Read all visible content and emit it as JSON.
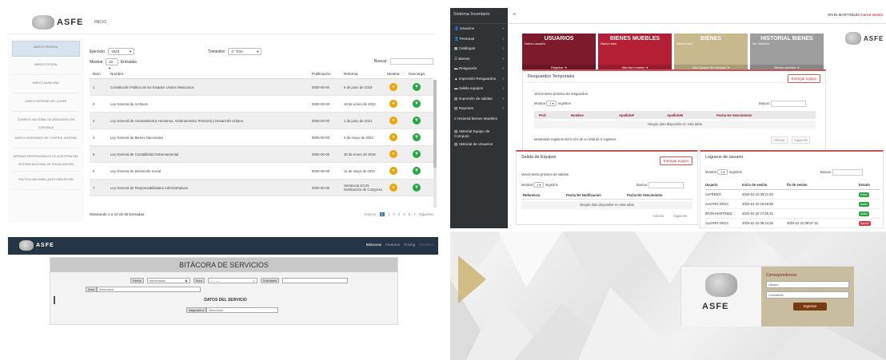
{
  "q1": {
    "brand": "ASFE",
    "header_title": "INICIO",
    "sidebar": [
      "MARCO FEDERAL",
      "MARCO ESTATAL",
      "MARCO MUNICIPAL",
      "MARCO INTERNO DE LA ASFE",
      "CONSEJO NACIONAL DE ARMONIZACIÓN CONTABLE",
      "MARCO INTEGRADO DE CONTROL INTERNO",
      "NORMAS PROFESIONALES DE AUDITORÍA DEL SISTEMA NACIONAL DE FISCALIZACIÓN",
      "POLÍTICA NACIONAL ANTICORRUPCIÓN"
    ],
    "ejercicio_label": "Ejercicio:",
    "ejercicio_value": "2023",
    "trimestre_label": "Trimestre:",
    "trimestre_value": "2° Trim.",
    "mostrar_label": "Mostrar",
    "mostrar_value": "10",
    "entradas_label": "Entradas",
    "buscar_label": "Buscar:",
    "cols": [
      "Núm",
      "Nombre",
      "Publicación",
      "Reforma",
      "Mostrar",
      "Descarga"
    ],
    "rows": [
      {
        "n": "1",
        "name": "Constitución Política de los Estados Unidos Mexicanos",
        "pub": "0000-00-00",
        "ref": "6 de junio de 2023"
      },
      {
        "n": "2",
        "name": "Ley General de Archivos",
        "pub": "0000-00-00",
        "ref": "19 de enero de 2023"
      },
      {
        "n": "3",
        "name": "Ley General de Asentamientos Humanos, Ordenamiento Territorial y Desarrollo Urbano",
        "pub": "0000-00-00",
        "ref": "1 de junio de 2021"
      },
      {
        "n": "4",
        "name": "Ley General de Bienes Nacionales",
        "pub": "0000-00-00",
        "ref": "3 de mayo de 2023"
      },
      {
        "n": "5",
        "name": "Ley General de Contabilidad Gubernamental",
        "pub": "0000-00-00",
        "ref": "30 de enero de 2018"
      },
      {
        "n": "6",
        "name": "Ley General de Desarrollo Social",
        "pub": "0000-00-00",
        "ref": "11 de mayo de 2022"
      },
      {
        "n": "7",
        "name": "Ley General de Responsabilidades Administrativas",
        "pub": "0000-00-00",
        "ref": "Sentencia SCJN Notificación de Congreso"
      }
    ],
    "footer": "Mostrando 1 a 10 de 68 Entradas",
    "pager": [
      "Anterior",
      "1",
      "2",
      "3",
      "4",
      "5",
      "6",
      "7",
      "Siguiente"
    ],
    "colors": {
      "show": "#f0a500",
      "download": "#27a844"
    }
  },
  "q2": {
    "brand": "Sistema Inventario",
    "menu": [
      "Usuarios",
      "Personal",
      "Catálogos",
      "Bienes",
      "Resguardo",
      "Impresión Resguardos",
      "Salida equipos",
      "Impresión de salidas",
      "Reportes",
      "Historial bienes Muebles",
      "Historial Equipo de Computo",
      "Historial de Usuarios"
    ],
    "user": "IRVIN.MARTINEZ",
    "logout": "Cerrar sesión",
    "cards": [
      {
        "title": "USUARIOS",
        "sub": "Nuevo usuario",
        "btn": "Registrar",
        "color": "#7d1a2c"
      },
      {
        "title": "BIENES MUEBLES",
        "sub": "Nuevo bien",
        "btn": "Alta bien mueble",
        "color": "#b51f35"
      },
      {
        "title": "BIENES",
        "sub": "Nuevo bien",
        "btn": "Alta Equipos de cómputo",
        "color": "#c8b88e"
      },
      {
        "title": "HISTORIAL BIENES",
        "sub": "ver historial",
        "btn": "Bienes muebles",
        "color": "#9e9e9e"
      }
    ],
    "brand2": "ASFE",
    "resg": {
      "title": "Resguardos Temporales",
      "btn": "Entregar equipo",
      "note": "Vencimiento próximo de resguardos.",
      "mostrar": "Mostrar",
      "n": "4",
      "reg": "registros",
      "buscar": "Buscar:",
      "cols": [
        "Prof.",
        "Nombre",
        "ApellidoP",
        "ApellidoM",
        "Fecha De Vencimiento"
      ],
      "empty": "Ningún dato disponible en esta tabla",
      "foot": "Mostrando registros del 0 al 0 de un total de 0 registros",
      "prev": "Anterior",
      "next": "Siguiente"
    },
    "salida": {
      "title": "Salida de Equipos",
      "btn": "Entregar equipo",
      "note": "Vencimiento próximo de salidas",
      "mostrar": "Mostrar",
      "n": "4",
      "reg": "registros",
      "buscar": "Buscar:",
      "cols": [
        "Referencia",
        "Fecha De Notificacion",
        "Fecha De Vencimiento"
      ],
      "empty": "Ningún dato disponible en esta tabla",
      "prev": "Anterior",
      "next": "Siguiente"
    },
    "log": {
      "title": "Logueos de usuario",
      "mostrar": "Mostrar",
      "n": "4",
      "reg": "registros",
      "buscar": "Buscar:",
      "cols": [
        "Usuario",
        "Inicio de sesión",
        "fin de sesión",
        "Estado"
      ],
      "rows": [
        {
          "u": "ALFREDO",
          "i": "2024-01-10 09:21:53",
          "f": "",
          "s": "Activo",
          "c": "#28a745"
        },
        {
          "u": "ALVARO.VEGA",
          "i": "2024-01-10 16:56:56",
          "f": "",
          "s": "Activo",
          "c": "#28a745"
        },
        {
          "u": "IRVIN.MARTINEZ",
          "i": "2024-01-10 17:25:21",
          "f": "",
          "s": "Activo",
          "c": "#28a745"
        },
        {
          "u": "ALVARO.VEGA",
          "i": "2024-01-10 09:24:26",
          "f": "2024-01-10 09:57:15",
          "s": "Inactivo",
          "c": "#dc3545"
        }
      ]
    }
  },
  "q3": {
    "brand": "ASFE",
    "nav": [
      "Bitácoras",
      "Features",
      "Pricing",
      "Disabled"
    ],
    "title": "BITÁCORA DE SERVICIOS",
    "fecha_label": "Fecha",
    "fecha_ph": "dd/mm/aaaa",
    "hora_label": "Hora",
    "hora_ph": "--:-- ----",
    "sol_label": "Solicitante",
    "area_label": "Área",
    "area_ph": "Selecciona",
    "section": "DATOS DEL SERVICIO",
    "asig_label": "Asignado a",
    "asig_ph": "Selecciona"
  },
  "q4": {
    "brand": "ASFE",
    "title": "Correspondencia",
    "user_ph": "Usuario",
    "pass_ph": "Contraseña",
    "btn": "Ingresar"
  }
}
